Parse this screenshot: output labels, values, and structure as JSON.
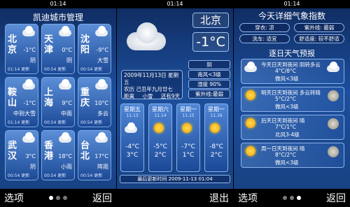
{
  "status_time": "01:14",
  "panel1": {
    "title": "凯迪城市管理",
    "cities": [
      {
        "name": "北京",
        "temp": "-1°C",
        "cond": "阴",
        "updated": "01:14 更新",
        "icon": "cloud-icon"
      },
      {
        "name": "天津",
        "temp": "0°C",
        "cond": "阴",
        "updated": "00:54 更新",
        "icon": "cloud-icon"
      },
      {
        "name": "沈阳",
        "temp": "-9°C",
        "cond": "大雪",
        "updated": "00:54 更新",
        "icon": "snow-cloud-icon"
      },
      {
        "name": "鞍山",
        "temp": "-1°C",
        "cond": "中到大雪",
        "updated": "01:14 更新",
        "icon": "snow-cloud-icon"
      },
      {
        "name": "上海",
        "temp": "9°C",
        "cond": "中雨",
        "updated": "00:54 更新",
        "icon": "rain-cloud-icon"
      },
      {
        "name": "重庆",
        "temp": "10°C",
        "cond": "多云",
        "updated": "00:54 更新",
        "icon": "cloud-icon"
      },
      {
        "name": "武汉",
        "temp": "3°C",
        "cond": "阴",
        "updated": "00:54 更新",
        "icon": "cloud-icon"
      },
      {
        "name": "香港",
        "temp": "18°C",
        "cond": "小雨",
        "updated": "00:54 更新",
        "icon": "rain-cloud-icon"
      },
      {
        "name": "台北",
        "temp": "17°C",
        "cond": "阵雨",
        "updated": "00:54 更新",
        "icon": "rain-cloud-icon"
      }
    ],
    "left_softkey": "选项",
    "right_softkey": "返回"
  },
  "panel2": {
    "city": "北京",
    "temperature": "-1°C",
    "info_line1": "2009年11月13日 星期五",
    "info_line2": "农历 己丑年九月廿七",
    "info_r3a": "距离",
    "info_r3b": "小雪",
    "info_r3c": "还有9天",
    "right_rows": [
      "阴",
      "南风<3级",
      "湿度 90%",
      "紫外线:最弱"
    ],
    "forecast": [
      {
        "day": "星期五",
        "date": "11.13",
        "hi": "-4°C",
        "lo": "3°C",
        "icon": "cloud-icon"
      },
      {
        "day": "星期六",
        "date": "11.14",
        "hi": "-5°C",
        "lo": "2°C",
        "icon": "sun-icon"
      },
      {
        "day": "星期一",
        "date": "11.15",
        "hi": "-7°C",
        "lo": "1°C",
        "icon": "sun-icon"
      },
      {
        "day": "星期一",
        "date": "11.16",
        "hi": "-8°C",
        "lo": "2°C",
        "icon": "sun-icon"
      }
    ],
    "updated": "最后更新时间 2009-11-13 01:04",
    "right_softkey": "退出"
  },
  "panel3": {
    "title": "今天详细气象指数",
    "indices": [
      "穿衣: 凉",
      "紫外线: 最弱",
      "洗车: 适宜",
      "舒适度: 较不舒适"
    ],
    "subtitle": "逐日天气预报",
    "rows": [
      {
        "l1": "今天日天到夜间   阴转多云",
        "l2": "4°C/8°C",
        "l3": "微风<3级",
        "icon_a": "cloud-icon",
        "icon_b": "cloud-icon"
      },
      {
        "l1": "明天日天到夜间   多云转晴",
        "l2": "5°C/2°C",
        "l3": "微风<3级",
        "icon_a": "sun-icon",
        "icon_b": "moon-icon"
      },
      {
        "l1": "后天日天到夜间       晴",
        "l2": "7°C/1°C",
        "l3": "北风3-4级",
        "icon_a": "sun-icon",
        "icon_b": "moon-icon"
      },
      {
        "l1": "周一日天到夜间       晴",
        "l2": "8°C/2°C",
        "l3": "微风<3级",
        "icon_a": "sun-icon",
        "icon_b": "moon-icon"
      }
    ],
    "left_softkey": "选项",
    "right_softkey": "返回"
  }
}
